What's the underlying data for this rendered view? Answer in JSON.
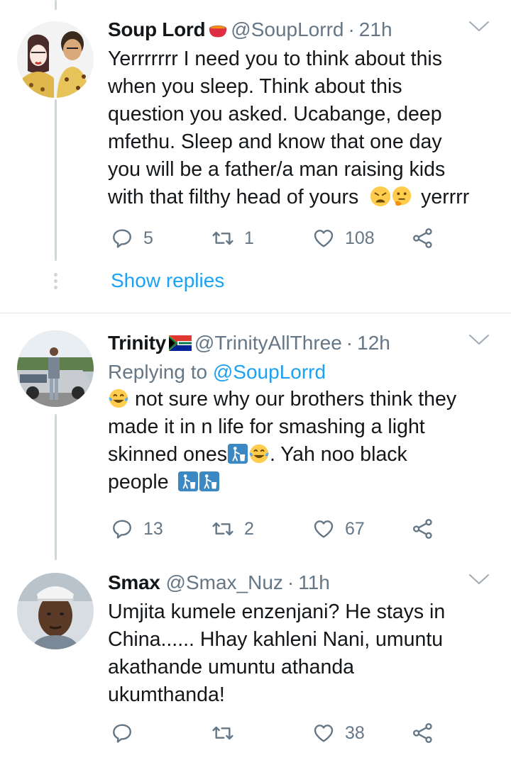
{
  "tweets": [
    {
      "name": "Soup Lord",
      "handle": "@SoupLorrd",
      "dot": "·",
      "time": "21h",
      "body_lines": [
        "Yerrrrrrr I need you to think about this",
        "when you sleep. Think about this",
        "question you asked. Ucabange, deep",
        "mfethu. Sleep and know that one day",
        "you will be a father/a man raising kids",
        "with that filthy head of yours"
      ],
      "body_tail": "yerrrr",
      "replies": "5",
      "retweets": "1",
      "likes": "108"
    },
    {
      "name": "Trinity",
      "handle": "@TrinityAllThree",
      "dot": "·",
      "time": "12h",
      "replying_prefix": "Replying to",
      "replying_to": "@SoupLorrd",
      "body_line1": "not sure why our brothers think they",
      "body_line2": "made it in n life for smashing a light",
      "body_line3a": "skinned ones",
      "body_line3b": ". Yah noo black",
      "body_line4": "people",
      "replies": "13",
      "retweets": "2",
      "likes": "67"
    },
    {
      "name": "Smax",
      "handle": "@Smax_Nuz",
      "dot": "·",
      "time": "11h",
      "body_lines": [
        "Umjita kumele enzenjani? He stays in",
        "China...... Hhay kahleni Nani, umuntu",
        "akathande umuntu athanda",
        "ukumthanda!"
      ],
      "replies": "",
      "retweets": "",
      "likes": "38"
    }
  ],
  "show_replies": "Show replies",
  "colors": {
    "accent": "#1da1f2",
    "muted": "#657786",
    "text": "#14171a",
    "line": "#ccd6dd"
  },
  "icons": [
    "reply-icon",
    "retweet-icon",
    "like-icon",
    "share-icon",
    "chevron-down-icon",
    "soup-pot-emoji",
    "south-africa-flag",
    "weary-face-emoji",
    "thinking-face-emoji",
    "tears-of-joy-emoji",
    "litter-bin-emoji"
  ]
}
